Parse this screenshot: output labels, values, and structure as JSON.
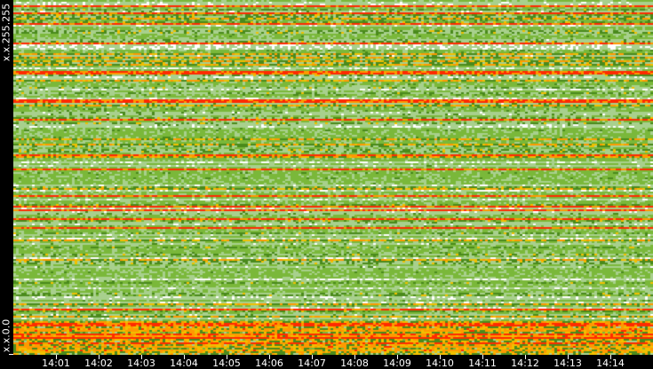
{
  "chart_data": {
    "type": "heatmap",
    "title": "",
    "xlabel": "",
    "ylabel": "",
    "x_tick_labels": [
      "14:01",
      "14:02",
      "14:03",
      "14:04",
      "14:05",
      "14:06",
      "14:07",
      "14:08",
      "14:09",
      "14:10",
      "14:11",
      "14:12",
      "14:13",
      "14:14"
    ],
    "y_tick_labels": {
      "bottom": "x.x.0.0",
      "top": "x.x.255.255"
    },
    "color_scale": [
      "#ffffff",
      "#a8d08d",
      "#7ab83a",
      "#4a8a1c",
      "#f0c000",
      "#ff9900",
      "#ff2a00"
    ],
    "grid": false,
    "legend": "none"
  }
}
